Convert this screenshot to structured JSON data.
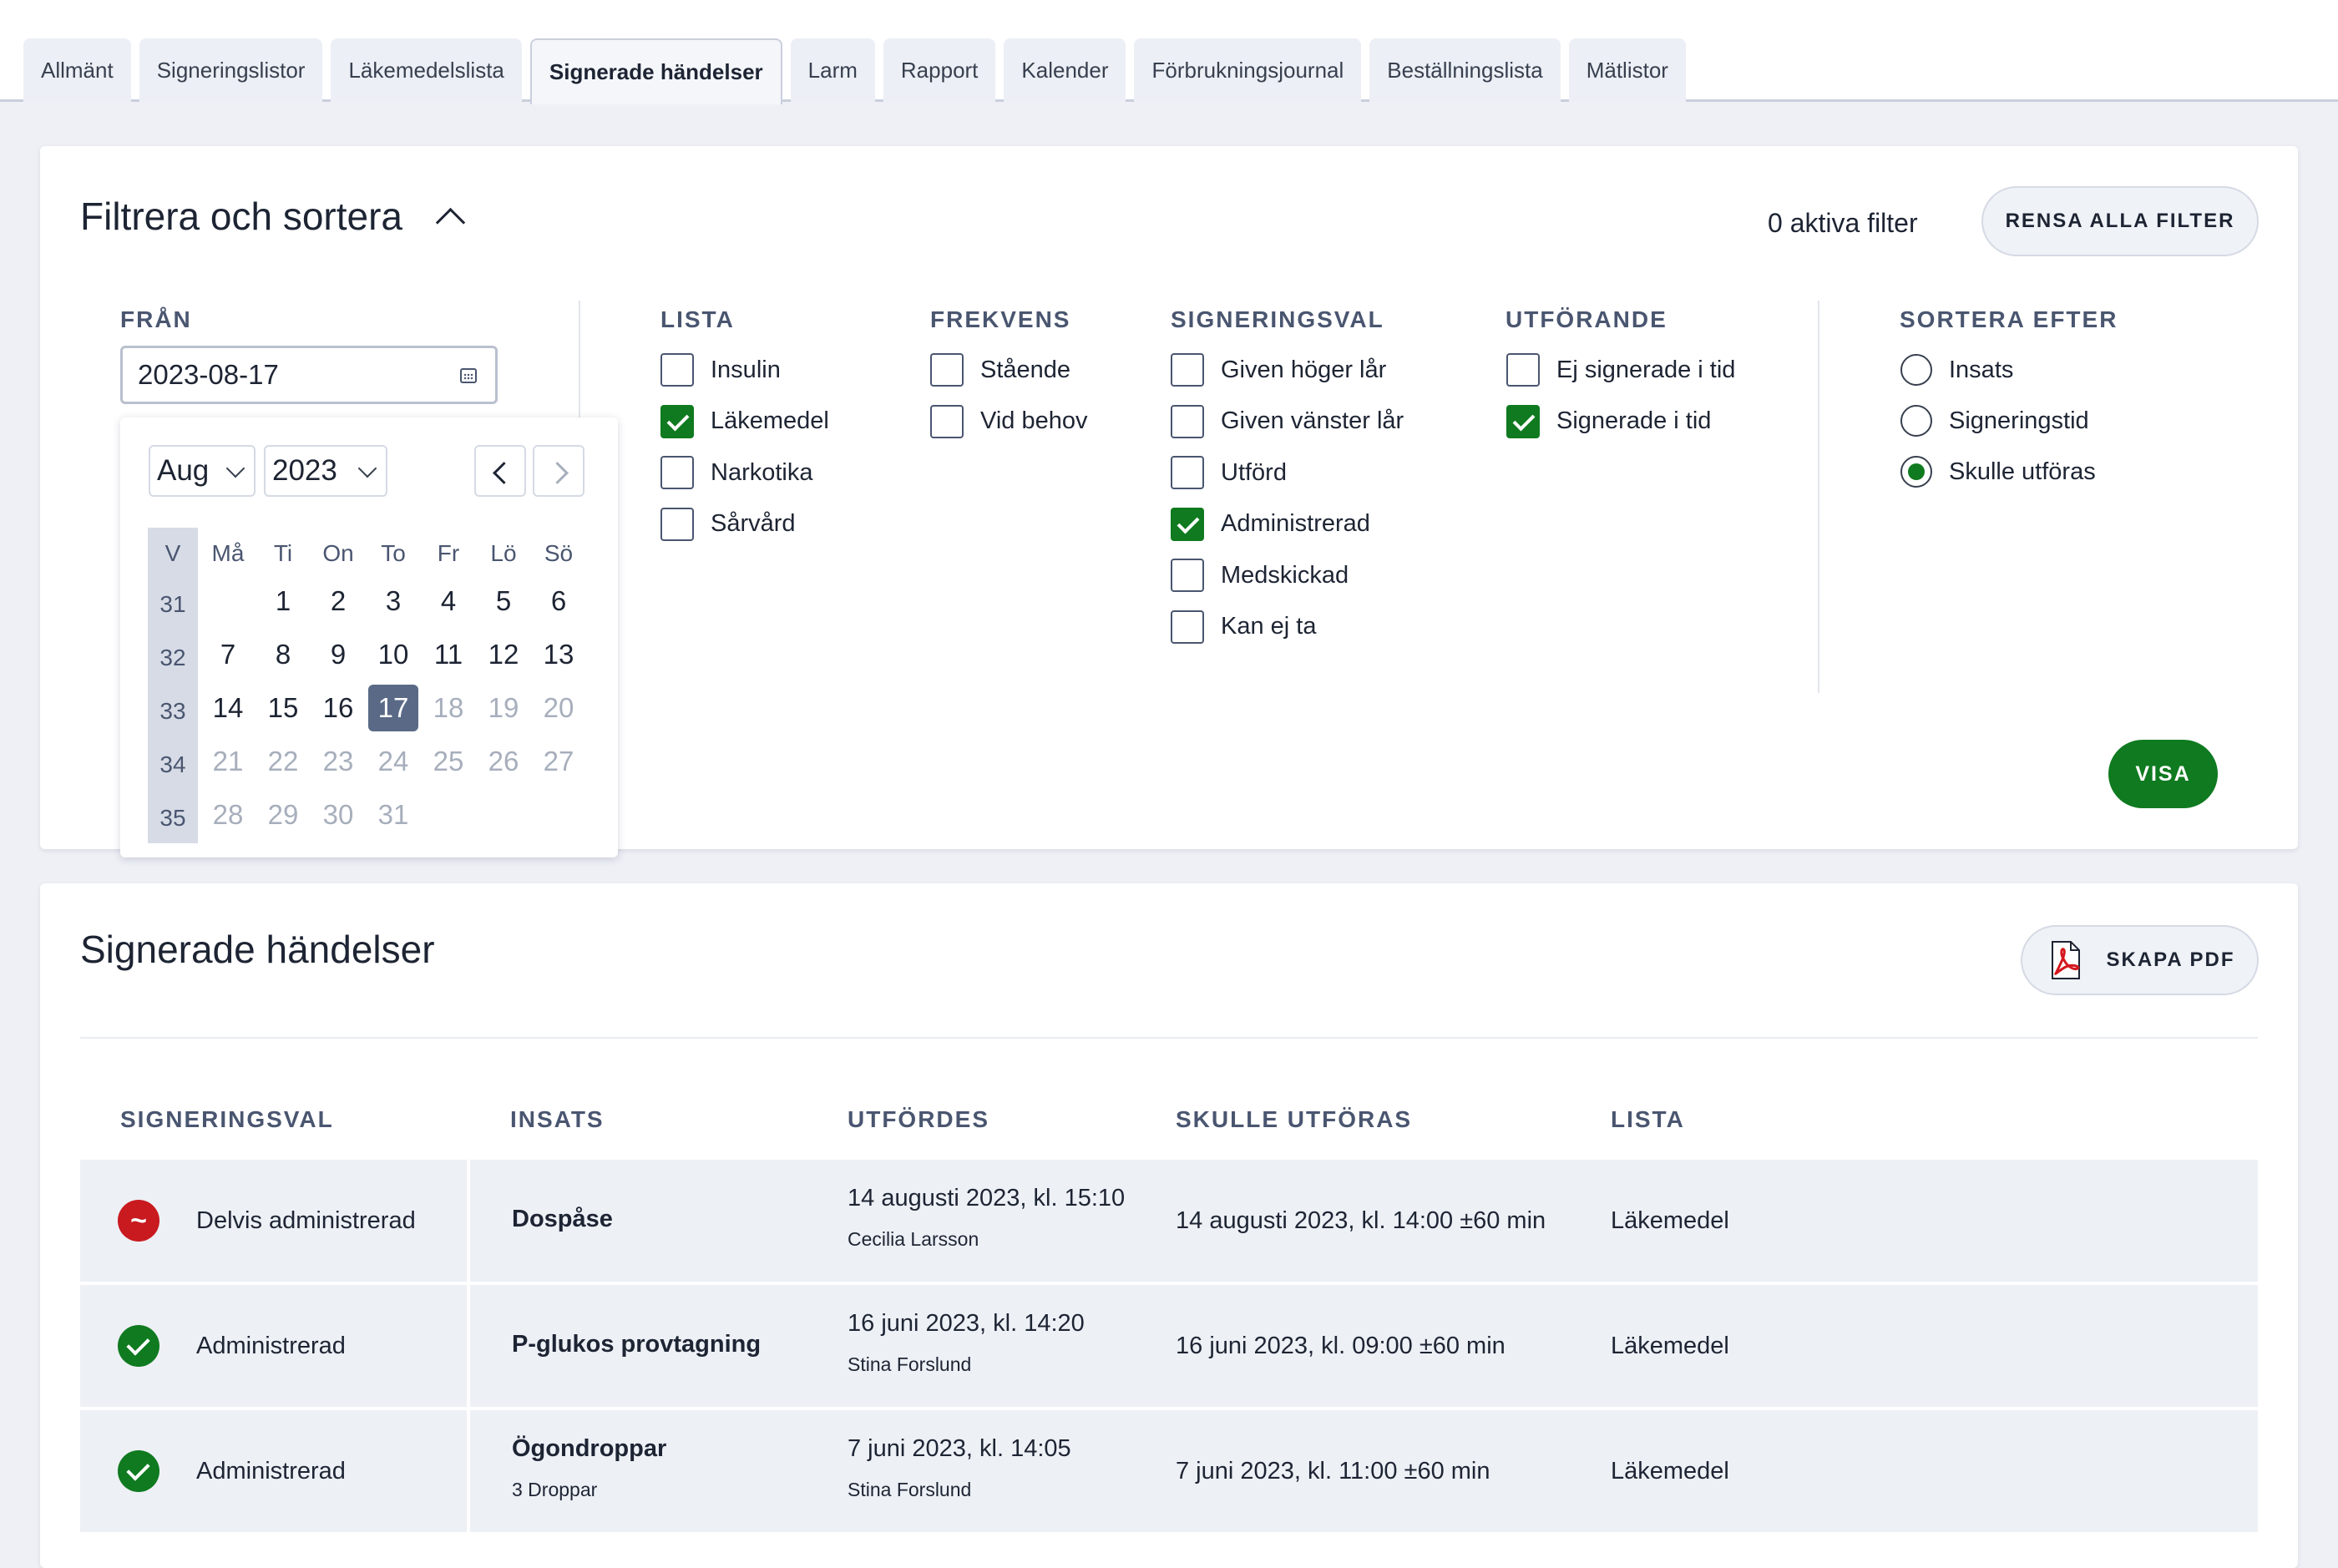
{
  "tabs": [
    {
      "label": "Allmänt"
    },
    {
      "label": "Signeringslistor"
    },
    {
      "label": "Läkemedelslista"
    },
    {
      "label": "Signerade händelser",
      "active": true
    },
    {
      "label": "Larm"
    },
    {
      "label": "Rapport"
    },
    {
      "label": "Kalender"
    },
    {
      "label": "Förbrukningsjournal"
    },
    {
      "label": "Beställningslista"
    },
    {
      "label": "Mätlistor"
    }
  ],
  "filter": {
    "title": "Filtrera och sortera",
    "active_count_label": "0 aktiva filter",
    "clear_label": "RENSA ALLA FILTER",
    "show_label": "VISA",
    "from_label": "FRÅN",
    "from_value": "2023-08-17",
    "calendar": {
      "month": "Aug",
      "year": "2023",
      "week_header": "V",
      "day_headers": [
        "Må",
        "Ti",
        "On",
        "To",
        "Fr",
        "Lö",
        "Sö"
      ],
      "weeks": [
        {
          "week": "31",
          "days": [
            "",
            "1",
            "2",
            "3",
            "4",
            "5",
            "6"
          ]
        },
        {
          "week": "32",
          "days": [
            "7",
            "8",
            "9",
            "10",
            "11",
            "12",
            "13"
          ]
        },
        {
          "week": "33",
          "days": [
            "14",
            "15",
            "16",
            "17",
            "18",
            "19",
            "20"
          ]
        },
        {
          "week": "34",
          "days": [
            "21",
            "22",
            "23",
            "24",
            "25",
            "26",
            "27"
          ]
        },
        {
          "week": "35",
          "days": [
            "28",
            "29",
            "30",
            "31",
            "",
            "",
            ""
          ]
        }
      ],
      "selected_day": "17"
    },
    "lista": {
      "label": "LISTA",
      "options": [
        {
          "label": "Insulin",
          "checked": false
        },
        {
          "label": "Läkemedel",
          "checked": true
        },
        {
          "label": "Narkotika",
          "checked": false
        },
        {
          "label": "Sårvård",
          "checked": false
        }
      ]
    },
    "frekvens": {
      "label": "FREKVENS",
      "options": [
        {
          "label": "Stående",
          "checked": false
        },
        {
          "label": "Vid behov",
          "checked": false
        }
      ]
    },
    "signeringsval": {
      "label": "SIGNERINGSVAL",
      "options": [
        {
          "label": "Given höger lår",
          "checked": false
        },
        {
          "label": "Given vänster lår",
          "checked": false
        },
        {
          "label": "Utförd",
          "checked": false
        },
        {
          "label": "Administrerad",
          "checked": true
        },
        {
          "label": "Medskickad",
          "checked": false
        },
        {
          "label": "Kan ej ta",
          "checked": false
        }
      ]
    },
    "utforande": {
      "label": "UTFÖRANDE",
      "options": [
        {
          "label": "Ej signerade i tid",
          "checked": false
        },
        {
          "label": "Signerade i tid",
          "checked": true
        }
      ]
    },
    "sortera": {
      "label": "SORTERA EFTER",
      "options": [
        {
          "label": "Insats",
          "checked": false
        },
        {
          "label": "Signeringstid",
          "checked": false
        },
        {
          "label": "Skulle utföras",
          "checked": true
        }
      ]
    }
  },
  "events": {
    "title": "Signerade händelser",
    "pdf_label": "SKAPA PDF",
    "columns": [
      "SIGNERINGSVAL",
      "INSATS",
      "UTFÖRDES",
      "SKULLE UTFÖRAS",
      "LISTA"
    ],
    "rows": [
      {
        "status": "partial",
        "status_glyph": "~",
        "signeringsval": "Delvis administrerad",
        "insats": "Dospåse",
        "insats_sub": "",
        "utfordes": "14 augusti 2023, kl. 15:10",
        "utfordes_by": "Cecilia Larsson",
        "skulle": "14 augusti 2023, kl. 14:00 ±60 min",
        "lista": "Läkemedel"
      },
      {
        "status": "ok",
        "status_glyph": "",
        "signeringsval": "Administrerad",
        "insats": "P-glukos provtagning",
        "insats_sub": "",
        "utfordes": "16 juni 2023, kl. 14:20",
        "utfordes_by": "Stina Forslund",
        "skulle": "16 juni 2023, kl. 09:00 ±60 min",
        "lista": "Läkemedel"
      },
      {
        "status": "ok",
        "status_glyph": "",
        "signeringsval": "Administrerad",
        "insats": "Ögondroppar",
        "insats_sub": "3 Droppar",
        "utfordes": "7 juni 2023, kl. 14:05",
        "utfordes_by": "Stina Forslund",
        "skulle": "7 juni 2023, kl. 11:00 ±60 min",
        "lista": "Läkemedel"
      }
    ]
  },
  "colors": {
    "accent_green": "#0f7a1f",
    "partial_red": "#c81a1f",
    "selected_day": "#5a6a86"
  }
}
